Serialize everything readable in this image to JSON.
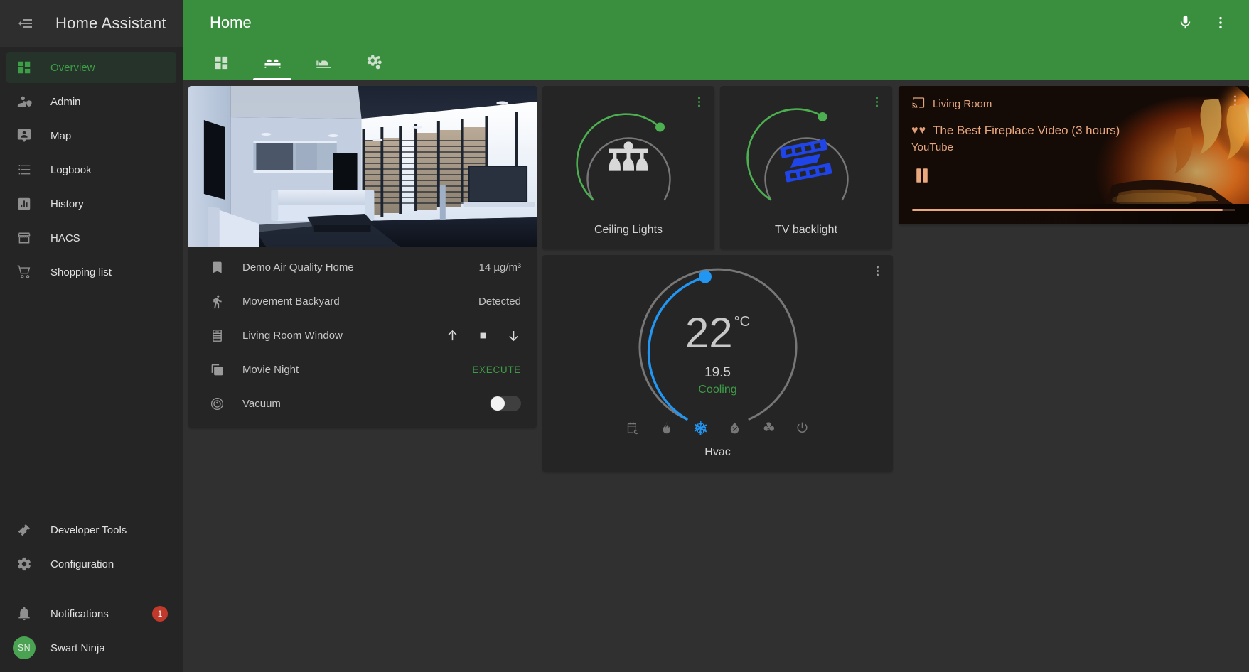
{
  "sidebar": {
    "title": "Home Assistant",
    "menu_icon": "menu-collapse-icon",
    "top_items": [
      {
        "label": "Overview",
        "icon": "view-dashboard-icon",
        "active": true
      },
      {
        "label": "Admin",
        "icon": "account-shield-icon",
        "active": false
      },
      {
        "label": "Map",
        "icon": "map-marker-account-icon",
        "active": false
      },
      {
        "label": "Logbook",
        "icon": "format-list-bulleted-icon",
        "active": false
      },
      {
        "label": "History",
        "icon": "chart-box-icon",
        "active": false
      },
      {
        "label": "HACS",
        "icon": "storefront-icon",
        "active": false
      },
      {
        "label": "Shopping list",
        "icon": "cart-icon",
        "active": false
      }
    ],
    "bottom_items": [
      {
        "label": "Developer Tools",
        "icon": "hammer-icon"
      },
      {
        "label": "Configuration",
        "icon": "gear-icon"
      }
    ],
    "notifications": {
      "label": "Notifications",
      "icon": "bell-icon",
      "count": "1"
    },
    "user": {
      "label": "Swart Ninja",
      "initials": "SN"
    }
  },
  "toolbar": {
    "title": "Home",
    "mic_icon": "microphone-icon",
    "overflow_icon": "dots-vertical-icon",
    "tabs": [
      {
        "icon": "view-dashboard-icon",
        "name": "tab-home",
        "active": false
      },
      {
        "icon": "sofa-icon",
        "name": "tab-living-room",
        "active": true
      },
      {
        "icon": "bed-icon",
        "name": "tab-bedroom",
        "active": false
      },
      {
        "icon": "cogs-icon",
        "name": "tab-settings",
        "active": false
      }
    ]
  },
  "colors": {
    "accent_green": "#3a8f3e",
    "card_bg": "#252525",
    "page_bg": "#303030",
    "active_blue": "#2196f3",
    "media_accent": "#e9a87e",
    "badge_red": "#c0392b"
  },
  "picture_card": {
    "image_alt": "living-room-3d-render",
    "entities": [
      {
        "icon": "bookmark-icon",
        "name": "Demo Air Quality Home",
        "value": "14 µg/m³",
        "control": "text"
      },
      {
        "icon": "run-icon",
        "name": "Movement Backyard",
        "value": "Detected",
        "control": "text"
      },
      {
        "icon": "blinds-icon",
        "name": "Living Room Window",
        "value": "",
        "control": "cover",
        "buttons": [
          "arrow-up-icon",
          "stop-square-icon",
          "arrow-down-icon"
        ]
      },
      {
        "icon": "script-icon",
        "name": "Movie Night",
        "value": "EXECUTE",
        "control": "execute"
      },
      {
        "icon": "robot-vacuum-icon",
        "name": "Vacuum",
        "value": "",
        "control": "toggle",
        "toggle_on": false
      }
    ]
  },
  "lights": [
    {
      "name": "Ceiling Lights",
      "icon": "ceiling-light-icon",
      "state": "on",
      "brightness_percent": 70,
      "ring_color": "#4caf50",
      "track_color": "#777777",
      "icon_color": "#d8d8d8",
      "more_icon": "dots-vertical-icon"
    },
    {
      "name": "TV backlight",
      "icon": "led-strip-icon",
      "state": "on",
      "brightness_percent": 88,
      "ring_color": "#4caf50",
      "track_color": "#777777",
      "icon_color": "#1f45e8",
      "more_icon": "dots-vertical-icon"
    }
  ],
  "thermostat": {
    "name": "Hvac",
    "target_temperature": "22",
    "unit": "°C",
    "current_temperature": "19.5",
    "action": "Cooling",
    "ring_color": "#2196f3",
    "track_color": "#777777",
    "dial_percent": 44,
    "more_icon": "dots-vertical-icon",
    "modes": [
      {
        "icon": "calendar-sync-icon",
        "name": "auto",
        "active": false
      },
      {
        "icon": "fire-icon",
        "name": "heat",
        "active": false
      },
      {
        "icon": "snowflake-icon",
        "name": "cool",
        "active": true
      },
      {
        "icon": "water-percent-icon",
        "name": "dry",
        "active": false
      },
      {
        "icon": "fan-icon",
        "name": "fan-only",
        "active": false
      },
      {
        "icon": "power-icon",
        "name": "off",
        "active": false
      }
    ]
  },
  "media_player": {
    "source_icon": "cast-connected-icon",
    "source": "Living Room",
    "hearts": "♥♥",
    "title": "The Best Fireplace Video (3 hours)",
    "app": "YouTube",
    "control_icon": "pause-icon",
    "progress_percent": 96,
    "more_icon": "dots-vertical-icon",
    "artwork_alt": "fireplace-artwork"
  }
}
